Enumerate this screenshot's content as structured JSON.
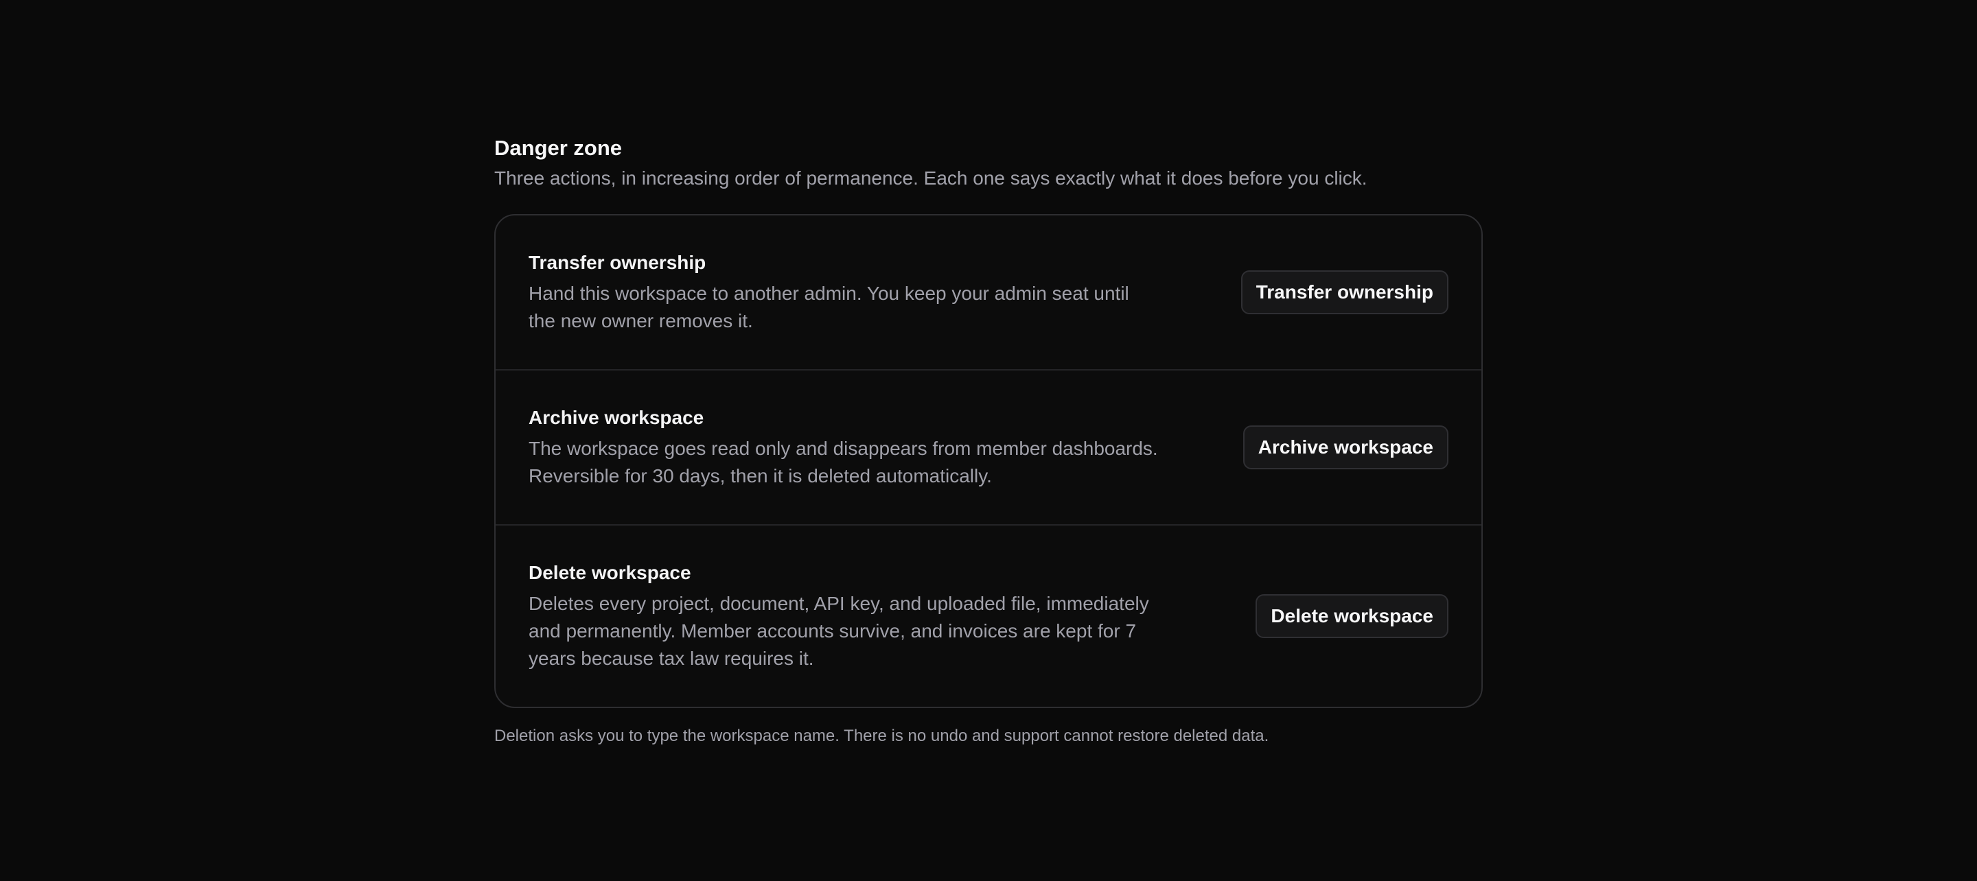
{
  "header": {
    "title": "Danger zone",
    "subtitle": "Three actions, in increasing order of permanence. Each one says exactly what it does before you click."
  },
  "actions": [
    {
      "title": "Transfer ownership",
      "description": "Hand this workspace to another admin. You keep your admin seat until the new owner removes it.",
      "button_label": "Transfer ownership"
    },
    {
      "title": "Archive workspace",
      "description": "The workspace goes read only and disappears from member dashboards. Reversible for 30 days, then it is deleted automatically.",
      "button_label": "Archive workspace"
    },
    {
      "title": "Delete workspace",
      "description": "Deletes every project, document, API key, and uploaded file, immediately and permanently. Member accounts survive, and invoices are kept for 7 years because tax law requires it.",
      "button_label": "Delete workspace"
    }
  ],
  "footnote": "Deletion asks you to type the workspace name. There is no undo and support cannot restore deleted data.",
  "colors": {
    "background": "#0a0a0a",
    "card_border": "#2e2e31",
    "muted_text": "#a1a1aa",
    "button_bg": "#171718"
  }
}
